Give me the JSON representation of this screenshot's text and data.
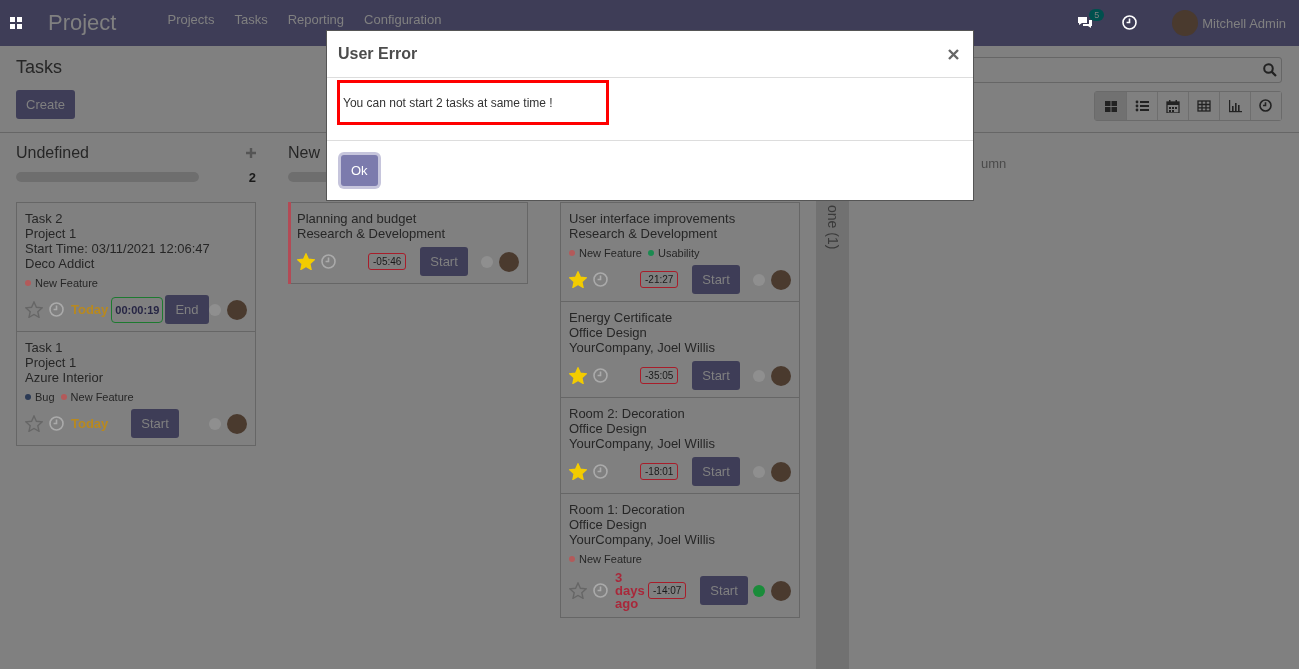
{
  "navbar": {
    "app_title": "Project",
    "menu": [
      "Projects",
      "Tasks",
      "Reporting",
      "Configuration"
    ],
    "message_count": "5",
    "user": "Mitchell Admin"
  },
  "control_panel": {
    "title": "Tasks",
    "create_button": "Create",
    "views": [
      {
        "kind": "kanban",
        "selected": true
      },
      {
        "kind": "list",
        "selected": false
      },
      {
        "kind": "calendar",
        "selected": false
      },
      {
        "kind": "pivot",
        "selected": false
      },
      {
        "kind": "graph",
        "selected": false
      },
      {
        "kind": "activity",
        "selected": false
      }
    ]
  },
  "columns": [
    {
      "title": "Undefined",
      "count": "2",
      "progress": {
        "level": 1
      },
      "cards": [
        {
          "lines": [
            "Task 2",
            "Project 1",
            "Start Time: 03/11/2021 12:06:47",
            "Deco Addict"
          ],
          "tags": [
            {
              "label": "New Feature",
              "color": "#b35a5a"
            }
          ],
          "starred": false,
          "date": {
            "text": "Today",
            "kind": "today"
          },
          "timer": {
            "text": "00:00:19",
            "kind": "running"
          },
          "button": "End",
          "status": {
            "color": "#8f8f8f"
          }
        },
        {
          "lines": [
            "Task 1",
            "Project 1",
            "Azure Interior"
          ],
          "tags": [
            {
              "label": "Bug",
              "color": "#2b3a55"
            },
            {
              "label": "New Feature",
              "color": "#b35a5a"
            }
          ],
          "starred": false,
          "date": {
            "text": "Today",
            "kind": "today"
          },
          "button": "Start",
          "status": {
            "color": "#8f8f8f"
          }
        }
      ]
    },
    {
      "title": "New",
      "progress": {
        "level": 1
      },
      "cards": [
        {
          "lines": [
            "Planning and budget",
            "Research & Development"
          ],
          "color": "#b34a55",
          "starred": true,
          "timer": {
            "text": "-05:46",
            "kind": "overdue"
          },
          "button": "Start",
          "status": {
            "color": "#8f8f8f"
          }
        }
      ]
    },
    {
      "cards": [
        {
          "lines": [
            "User interface improvements",
            "Research & Development"
          ],
          "tags": [
            {
              "label": "New Feature",
              "color": "#b35a5a"
            },
            {
              "label": "Usability",
              "color": "#1a8a50"
            }
          ],
          "starred": true,
          "timer": {
            "text": "-21:27",
            "kind": "overdue"
          },
          "button": "Start",
          "status": {
            "color": "#8f8f8f"
          }
        },
        {
          "lines": [
            "Energy Certificate",
            "Office Design",
            "YourCompany, Joel Willis"
          ],
          "starred": true,
          "timer": {
            "text": "-35:05",
            "kind": "overdue"
          },
          "button": "Start",
          "status": {
            "color": "#8f8f8f"
          }
        },
        {
          "lines": [
            "Room 2: Decoration",
            "Office Design",
            "YourCompany, Joel Willis"
          ],
          "starred": true,
          "timer": {
            "text": "-18:01",
            "kind": "overdue"
          },
          "button": "Start",
          "status": {
            "color": "#8f8f8f"
          }
        },
        {
          "lines": [
            "Room 1: Decoration",
            "Office Design",
            "YourCompany, Joel Willis"
          ],
          "tags": [
            {
              "label": "New Feature",
              "color": "#b35a5a"
            }
          ],
          "starred": false,
          "date": {
            "text": "3 days ago",
            "kind": "overdue"
          },
          "timer": {
            "text": "-14:07",
            "kind": "overdue"
          },
          "button": "Start",
          "status": {
            "color": "#1a8c3a"
          }
        }
      ]
    }
  ],
  "folded_column": {
    "title": "one (1)"
  },
  "add_column": {
    "label": "umn"
  },
  "dialog": {
    "title": "User Error",
    "message": "You can not start 2 tasks at same time !",
    "ok_button": "Ok"
  }
}
